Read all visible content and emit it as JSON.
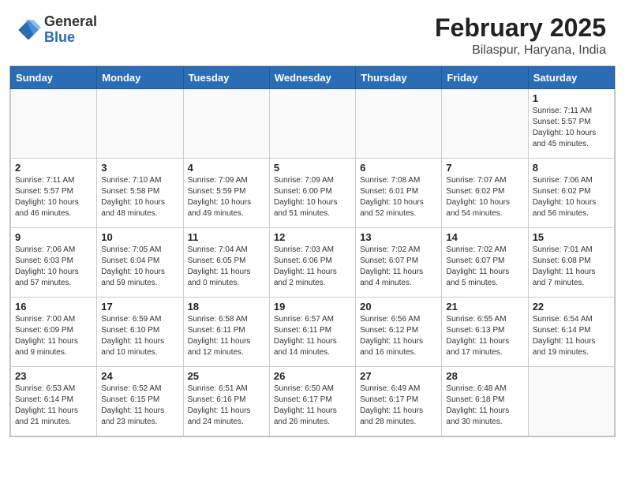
{
  "header": {
    "logo_general": "General",
    "logo_blue": "Blue",
    "month_year": "February 2025",
    "location": "Bilaspur, Haryana, India"
  },
  "days_of_week": [
    "Sunday",
    "Monday",
    "Tuesday",
    "Wednesday",
    "Thursday",
    "Friday",
    "Saturday"
  ],
  "weeks": [
    [
      {
        "day": "",
        "info": ""
      },
      {
        "day": "",
        "info": ""
      },
      {
        "day": "",
        "info": ""
      },
      {
        "day": "",
        "info": ""
      },
      {
        "day": "",
        "info": ""
      },
      {
        "day": "",
        "info": ""
      },
      {
        "day": "1",
        "info": "Sunrise: 7:11 AM\nSunset: 5:57 PM\nDaylight: 10 hours\nand 45 minutes."
      }
    ],
    [
      {
        "day": "2",
        "info": "Sunrise: 7:11 AM\nSunset: 5:57 PM\nDaylight: 10 hours\nand 46 minutes."
      },
      {
        "day": "3",
        "info": "Sunrise: 7:10 AM\nSunset: 5:58 PM\nDaylight: 10 hours\nand 48 minutes."
      },
      {
        "day": "4",
        "info": "Sunrise: 7:09 AM\nSunset: 5:59 PM\nDaylight: 10 hours\nand 49 minutes."
      },
      {
        "day": "5",
        "info": "Sunrise: 7:09 AM\nSunset: 6:00 PM\nDaylight: 10 hours\nand 51 minutes."
      },
      {
        "day": "6",
        "info": "Sunrise: 7:08 AM\nSunset: 6:01 PM\nDaylight: 10 hours\nand 52 minutes."
      },
      {
        "day": "7",
        "info": "Sunrise: 7:07 AM\nSunset: 6:02 PM\nDaylight: 10 hours\nand 54 minutes."
      },
      {
        "day": "8",
        "info": "Sunrise: 7:06 AM\nSunset: 6:02 PM\nDaylight: 10 hours\nand 56 minutes."
      }
    ],
    [
      {
        "day": "9",
        "info": "Sunrise: 7:06 AM\nSunset: 6:03 PM\nDaylight: 10 hours\nand 57 minutes."
      },
      {
        "day": "10",
        "info": "Sunrise: 7:05 AM\nSunset: 6:04 PM\nDaylight: 10 hours\nand 59 minutes."
      },
      {
        "day": "11",
        "info": "Sunrise: 7:04 AM\nSunset: 6:05 PM\nDaylight: 11 hours\nand 0 minutes."
      },
      {
        "day": "12",
        "info": "Sunrise: 7:03 AM\nSunset: 6:06 PM\nDaylight: 11 hours\nand 2 minutes."
      },
      {
        "day": "13",
        "info": "Sunrise: 7:02 AM\nSunset: 6:07 PM\nDaylight: 11 hours\nand 4 minutes."
      },
      {
        "day": "14",
        "info": "Sunrise: 7:02 AM\nSunset: 6:07 PM\nDaylight: 11 hours\nand 5 minutes."
      },
      {
        "day": "15",
        "info": "Sunrise: 7:01 AM\nSunset: 6:08 PM\nDaylight: 11 hours\nand 7 minutes."
      }
    ],
    [
      {
        "day": "16",
        "info": "Sunrise: 7:00 AM\nSunset: 6:09 PM\nDaylight: 11 hours\nand 9 minutes."
      },
      {
        "day": "17",
        "info": "Sunrise: 6:59 AM\nSunset: 6:10 PM\nDaylight: 11 hours\nand 10 minutes."
      },
      {
        "day": "18",
        "info": "Sunrise: 6:58 AM\nSunset: 6:11 PM\nDaylight: 11 hours\nand 12 minutes."
      },
      {
        "day": "19",
        "info": "Sunrise: 6:57 AM\nSunset: 6:11 PM\nDaylight: 11 hours\nand 14 minutes."
      },
      {
        "day": "20",
        "info": "Sunrise: 6:56 AM\nSunset: 6:12 PM\nDaylight: 11 hours\nand 16 minutes."
      },
      {
        "day": "21",
        "info": "Sunrise: 6:55 AM\nSunset: 6:13 PM\nDaylight: 11 hours\nand 17 minutes."
      },
      {
        "day": "22",
        "info": "Sunrise: 6:54 AM\nSunset: 6:14 PM\nDaylight: 11 hours\nand 19 minutes."
      }
    ],
    [
      {
        "day": "23",
        "info": "Sunrise: 6:53 AM\nSunset: 6:14 PM\nDaylight: 11 hours\nand 21 minutes."
      },
      {
        "day": "24",
        "info": "Sunrise: 6:52 AM\nSunset: 6:15 PM\nDaylight: 11 hours\nand 23 minutes."
      },
      {
        "day": "25",
        "info": "Sunrise: 6:51 AM\nSunset: 6:16 PM\nDaylight: 11 hours\nand 24 minutes."
      },
      {
        "day": "26",
        "info": "Sunrise: 6:50 AM\nSunset: 6:17 PM\nDaylight: 11 hours\nand 26 minutes."
      },
      {
        "day": "27",
        "info": "Sunrise: 6:49 AM\nSunset: 6:17 PM\nDaylight: 11 hours\nand 28 minutes."
      },
      {
        "day": "28",
        "info": "Sunrise: 6:48 AM\nSunset: 6:18 PM\nDaylight: 11 hours\nand 30 minutes."
      },
      {
        "day": "",
        "info": ""
      }
    ]
  ]
}
